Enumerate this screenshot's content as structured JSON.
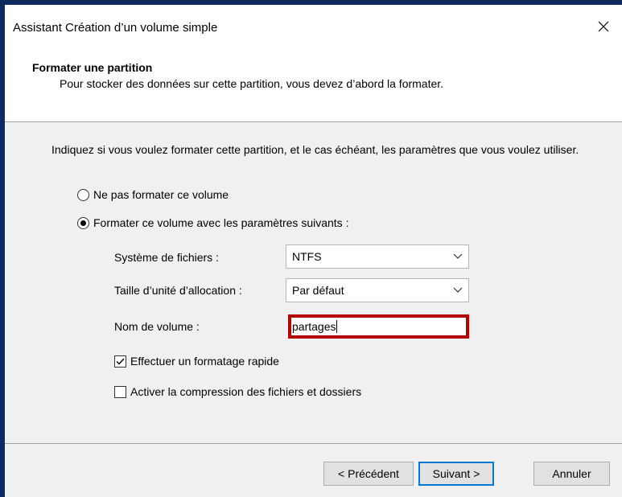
{
  "window": {
    "title": "Assistant Création d’un volume simple",
    "close_icon": "close-icon"
  },
  "header": {
    "title": "Formater une partition",
    "subtitle": "Pour stocker des données sur cette partition, vous devez d’abord la formater."
  },
  "intro": "Indiquez si vous voulez formater cette partition, et le cas échéant, les paramètres que vous voulez utiliser.",
  "options": {
    "no_format_label": "Ne pas formater ce volume",
    "format_label": "Formater ce volume avec les paramètres suivants :",
    "selected": "format"
  },
  "fields": {
    "filesystem_label": "Système de fichiers :",
    "filesystem_value": "NTFS",
    "allocation_label": "Taille d’unité d’allocation :",
    "allocation_value": "Par défaut",
    "volume_name_label": "Nom de volume :",
    "volume_name_value": "partages"
  },
  "checks": {
    "quick_format_label": "Effectuer un formatage rapide",
    "quick_format_checked": true,
    "compression_label": "Activer la compression des fichiers et dossiers",
    "compression_checked": false
  },
  "buttons": {
    "back": "< Précédent",
    "next": "Suivant >",
    "cancel": "Annuler"
  },
  "colors": {
    "highlight_border": "#b40000",
    "default_button_border": "#0078d7"
  }
}
